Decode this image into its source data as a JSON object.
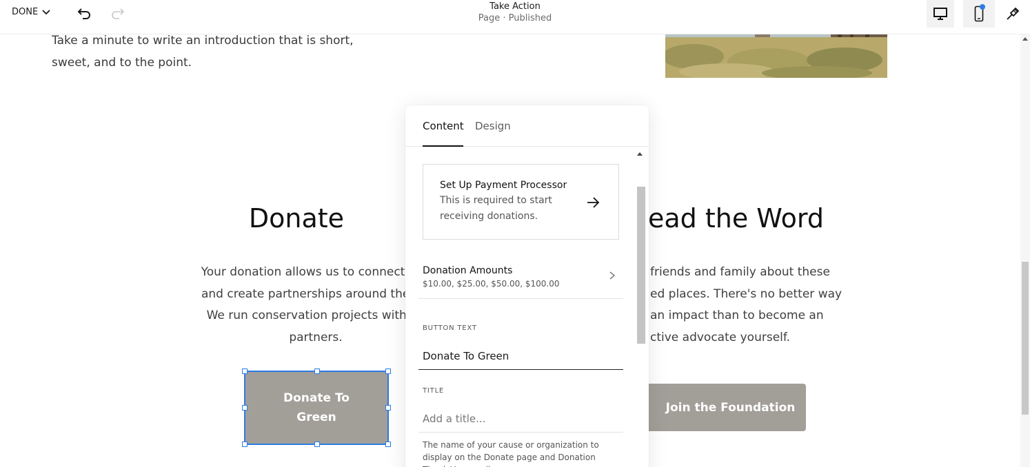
{
  "topbar": {
    "done_label": "DONE",
    "page_title": "Take Action",
    "page_status": "Page · Published"
  },
  "page": {
    "intro_line1": "Take a minute to write an introduction that is short,",
    "intro_line2": "sweet, and to the point.",
    "donate_title": "Donate",
    "donate_text_lines": [
      "Your donation allows us to connect peo",
      "and create partnerships around the wo",
      "We run conservation projects with ou",
      "partners."
    ],
    "donate_button": "Donate To Green",
    "spread_title": "ead the Word",
    "spread_text_lines": [
      "friends and family about these",
      "ed places. There's no better way",
      "an impact than to become an",
      "ctive advocate yourself."
    ],
    "join_button": "Join the Foundation"
  },
  "panel": {
    "tabs": [
      "Content",
      "Design"
    ],
    "active_tab": "Content",
    "processor_title": "Set Up Payment Processor",
    "processor_desc": "This is required to start receiving donations.",
    "amounts_title": "Donation Amounts",
    "amounts_values": "$10.00, $25.00, $50.00, $100.00",
    "button_text_label": "BUTTON TEXT",
    "button_text_value": "Donate To Green",
    "title_label": "TITLE",
    "title_placeholder": "Add a title...",
    "title_helper": "The name of your cause or organization to display on the Donate page and Donation Thank You email."
  },
  "colors": {
    "selection": "#2c7be5",
    "button_bg": "#a29f99"
  }
}
